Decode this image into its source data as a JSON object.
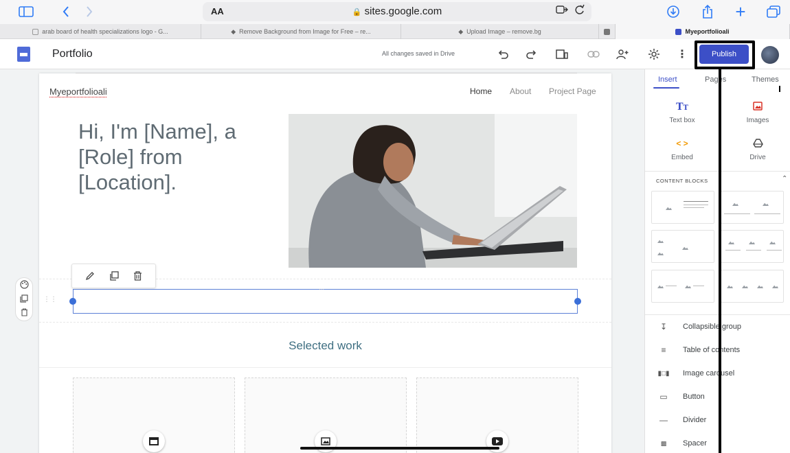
{
  "safari": {
    "address_aa": "AA",
    "url": "sites.google.com"
  },
  "tabs": [
    {
      "label": "arab board of health specializations logo - G...",
      "color": "#b0b0b0"
    },
    {
      "label": "Remove Background from Image for Free – re...",
      "color": "#555555"
    },
    {
      "label": "Upload Image – remove.bg",
      "color": "#555555"
    },
    {
      "label": "",
      "color": "#888888"
    },
    {
      "label": "Myeportfolioali",
      "color": "#3c4fc7"
    }
  ],
  "header": {
    "title": "Portfolio",
    "saved_status": "All changes saved in Drive",
    "publish_label": "Publish"
  },
  "site": {
    "name": "Myeportfolioali",
    "nav": [
      "Home",
      "About",
      "Project Page"
    ],
    "hero_text": "Hi, I'm [Name], a [Role] from [Location].",
    "section_title": "Selected work"
  },
  "panel": {
    "tabs": [
      "Insert",
      "Pages",
      "Themes"
    ],
    "insert_items": [
      {
        "label": "Text box",
        "icon": "text-box-icon"
      },
      {
        "label": "Images",
        "icon": "image-icon"
      },
      {
        "label": "Embed",
        "icon": "embed-icon"
      },
      {
        "label": "Drive",
        "icon": "drive-icon"
      }
    ],
    "content_blocks_label": "CONTENT BLOCKS",
    "list_items": [
      {
        "label": "Collapsible group",
        "icon": "collapsible-icon"
      },
      {
        "label": "Table of contents",
        "icon": "toc-icon"
      },
      {
        "label": "Image carousel",
        "icon": "carousel-icon"
      },
      {
        "label": "Button",
        "icon": "button-icon"
      },
      {
        "label": "Divider",
        "icon": "divider-icon"
      },
      {
        "label": "Spacer",
        "icon": "spacer-icon"
      }
    ]
  },
  "colors": {
    "accent": "#3c4fc7",
    "selection": "#5b7fd6",
    "hero_text": "#5f6b73",
    "section_title": "#3f6f82"
  }
}
